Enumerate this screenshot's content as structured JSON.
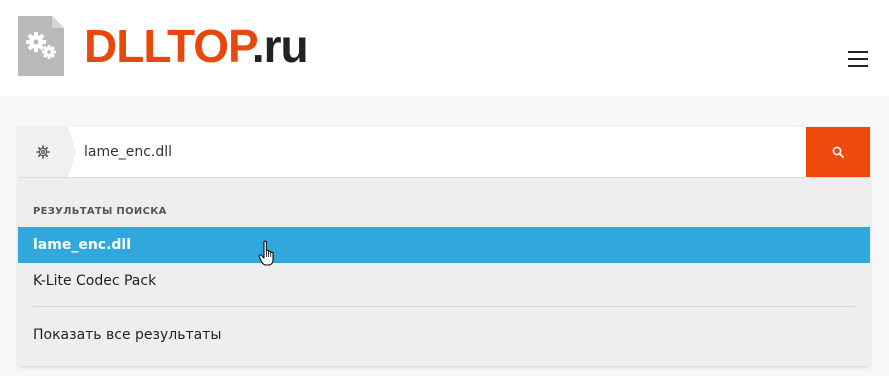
{
  "header": {
    "logo_icon": "settings-file-icon",
    "logo_brand": "DLLTOP",
    "logo_tld": ".ru",
    "menu_icon": "hamburger-menu-icon"
  },
  "search": {
    "type_icon": "gear-icon",
    "value": "lame_enc.dll",
    "submit_icon": "search-icon"
  },
  "dropdown": {
    "header": "РЕЗУЛЬТАТЫ ПОИСКА",
    "items": [
      {
        "label": "lame_enc.dll",
        "highlighted": true
      },
      {
        "label": "K-Lite Codec Pack",
        "highlighted": false
      }
    ],
    "show_all": "Показать все результаты"
  },
  "colors": {
    "brand": "#e8480c",
    "search_button": "#ee4a0c",
    "highlight": "#30a8dd"
  }
}
